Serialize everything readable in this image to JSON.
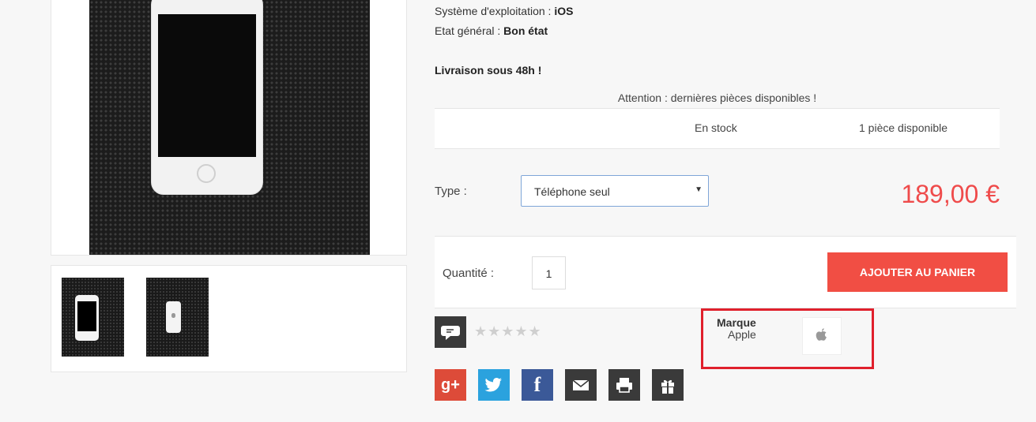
{
  "specs": [
    {
      "label": "Système d'exploitation :",
      "value": "iOS"
    },
    {
      "label": "Etat général :",
      "value": "Bon état"
    }
  ],
  "delivery": "Livraison sous 48h !",
  "attention": "Attention : dernières pièces disponibles !",
  "stock": {
    "status": "En stock",
    "quantity_text": "1 pièce disponible"
  },
  "type": {
    "label": "Type :",
    "selected": "Téléphone seul"
  },
  "price": "189,00 €",
  "quantity": {
    "label": "Quantité :",
    "value": "1"
  },
  "add_to_cart": "AJOUTER AU PANIER",
  "rating": {
    "stars": "★★★★★",
    "value": 0,
    "max": 5
  },
  "brand": {
    "label": "Marque",
    "name": "Apple"
  },
  "social": {
    "google_label": "g+",
    "facebook_label": "f"
  },
  "colors": {
    "accent": "#f14e44",
    "price": "#ef4b4b",
    "highlight": "#e0202c"
  },
  "icons": [
    "comment-icon",
    "google-plus-icon",
    "twitter-icon",
    "facebook-icon",
    "mail-icon",
    "print-icon",
    "gift-icon",
    "apple-logo-icon"
  ]
}
